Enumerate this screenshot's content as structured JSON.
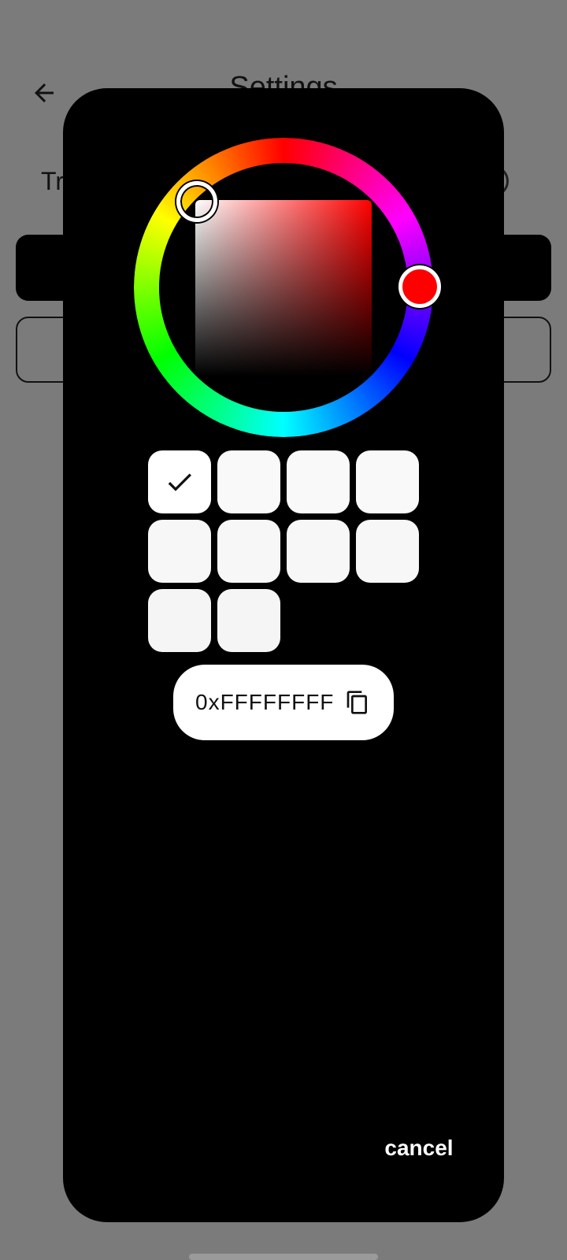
{
  "background_screen": {
    "title": "Settings",
    "row_label": "Tr"
  },
  "color_picker": {
    "selected_hue_color": "#ff0000",
    "hex_value": "0xFFFFFFFF",
    "swatches": [
      "#ffffff",
      "#f9f9f9",
      "#f9f9f9",
      "#f9f9f9",
      "#f7f7f7",
      "#f7f7f7",
      "#f7f7f7",
      "#f7f7f7",
      "#f5f5f5",
      "#f5f5f5"
    ],
    "selected_swatch_index": 0
  },
  "actions": {
    "cancel_label": "cancel"
  },
  "icons": {
    "back": "arrow-left-icon",
    "check": "check-icon",
    "copy": "copy-icon"
  }
}
